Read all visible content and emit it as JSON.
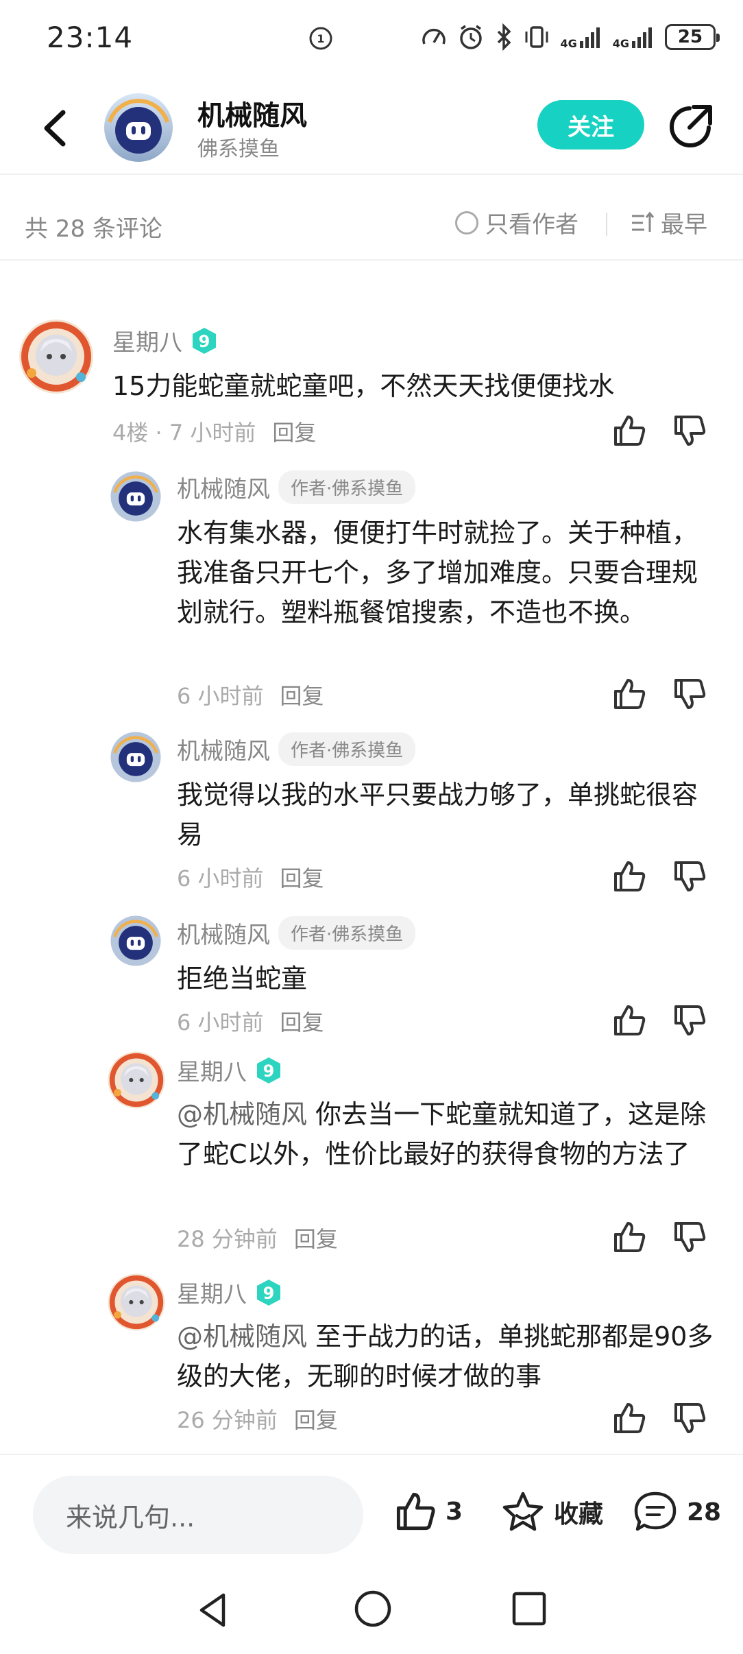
{
  "status_bar": {
    "time": "23:14",
    "battery": "25",
    "network_1": "4G",
    "network_2": "4G"
  },
  "header": {
    "author_name": "机械随风",
    "author_subtitle": "佛系摸鱼",
    "follow_label": "关注"
  },
  "sort_bar": {
    "count_text": "共 28 条评论",
    "only_author_label": "只看作者",
    "sort_label": "最早"
  },
  "comments": [
    {
      "name": "星期八",
      "level": "9",
      "text": "15力能蛇童就蛇童吧，不然天天找便便找水",
      "floor": "4楼 · 7 小时前",
      "reply_label": "回复"
    },
    {
      "name": "机械随风",
      "tag": "作者·佛系摸鱼",
      "text": "水有集水器，便便打牛时就捡了。关于种植，我准备只开七个，多了增加难度。只要合理规划就行。塑料瓶餐馆搜索，不造也不换。",
      "time": "6 小时前",
      "reply_label": "回复"
    },
    {
      "name": "机械随风",
      "tag": "作者·佛系摸鱼",
      "text": "我觉得以我的水平只要战力够了，单挑蛇很容易",
      "time": "6 小时前",
      "reply_label": "回复"
    },
    {
      "name": "机械随风",
      "tag": "作者·佛系摸鱼",
      "text": "拒绝当蛇童",
      "time": "6 小时前",
      "reply_label": "回复"
    },
    {
      "name": "星期八",
      "level": "9",
      "mention": "@机械随风",
      "text": "你去当一下蛇童就知道了，这是除了蛇C以外，性价比最好的获得食物的方法了",
      "time": "28 分钟前",
      "reply_label": "回复"
    },
    {
      "name": "星期八",
      "level": "9",
      "mention": "@机械随风",
      "text": "至于战力的话，单挑蛇那都是90多级的大佬，无聊的时候才做的事",
      "time": "26 分钟前",
      "reply_label": "回复"
    }
  ],
  "bottom_bar": {
    "input_placeholder": "来说几句...",
    "like_count": "3",
    "collect_label": "收藏",
    "comment_count": "28"
  },
  "colors": {
    "accent": "#17d2c2",
    "level_badge": "#2dd4bf"
  }
}
